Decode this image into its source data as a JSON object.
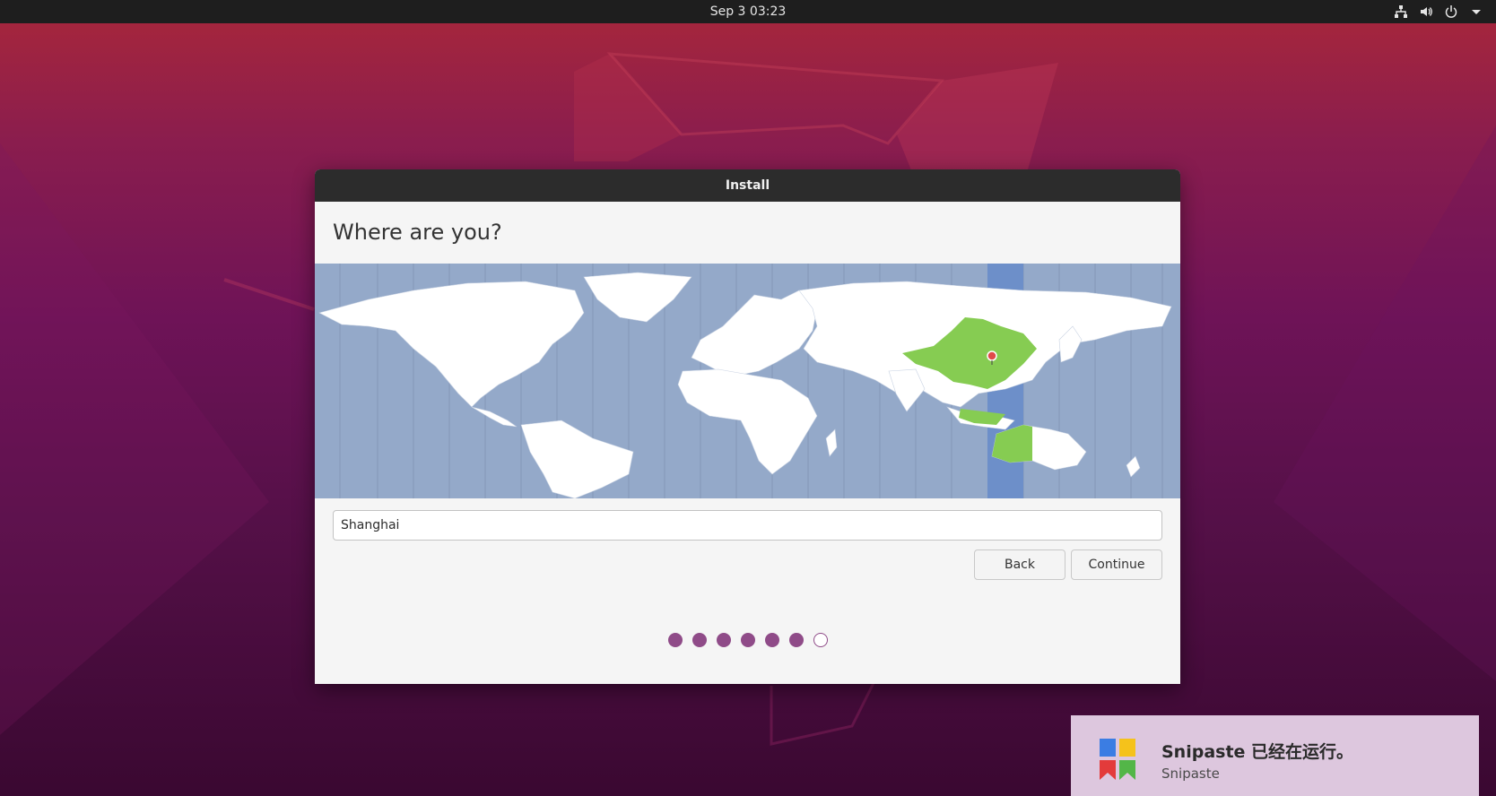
{
  "desktop": {
    "clock": "Sep 3  03:23",
    "tray_icons": [
      "network-icon",
      "volume-icon",
      "power-icon",
      "chevron-down-icon"
    ]
  },
  "installer": {
    "window_title": "Install",
    "heading": "Where are you?",
    "timezone_value": "Shanghai",
    "back_label": "Back",
    "continue_label": "Continue",
    "progress": {
      "total_steps": 7,
      "completed_steps": 6
    },
    "colors": {
      "map_ocean": "#94a9c9",
      "land": "#ffffff",
      "selected_region": "#86cc52",
      "selected_band": "#6d8fc9",
      "progress_dot": "#8f4b88"
    }
  },
  "notification": {
    "title": "Snipaste 已经在运行。",
    "app_name": "Snipaste",
    "icon": "snipaste-logo-icon"
  }
}
